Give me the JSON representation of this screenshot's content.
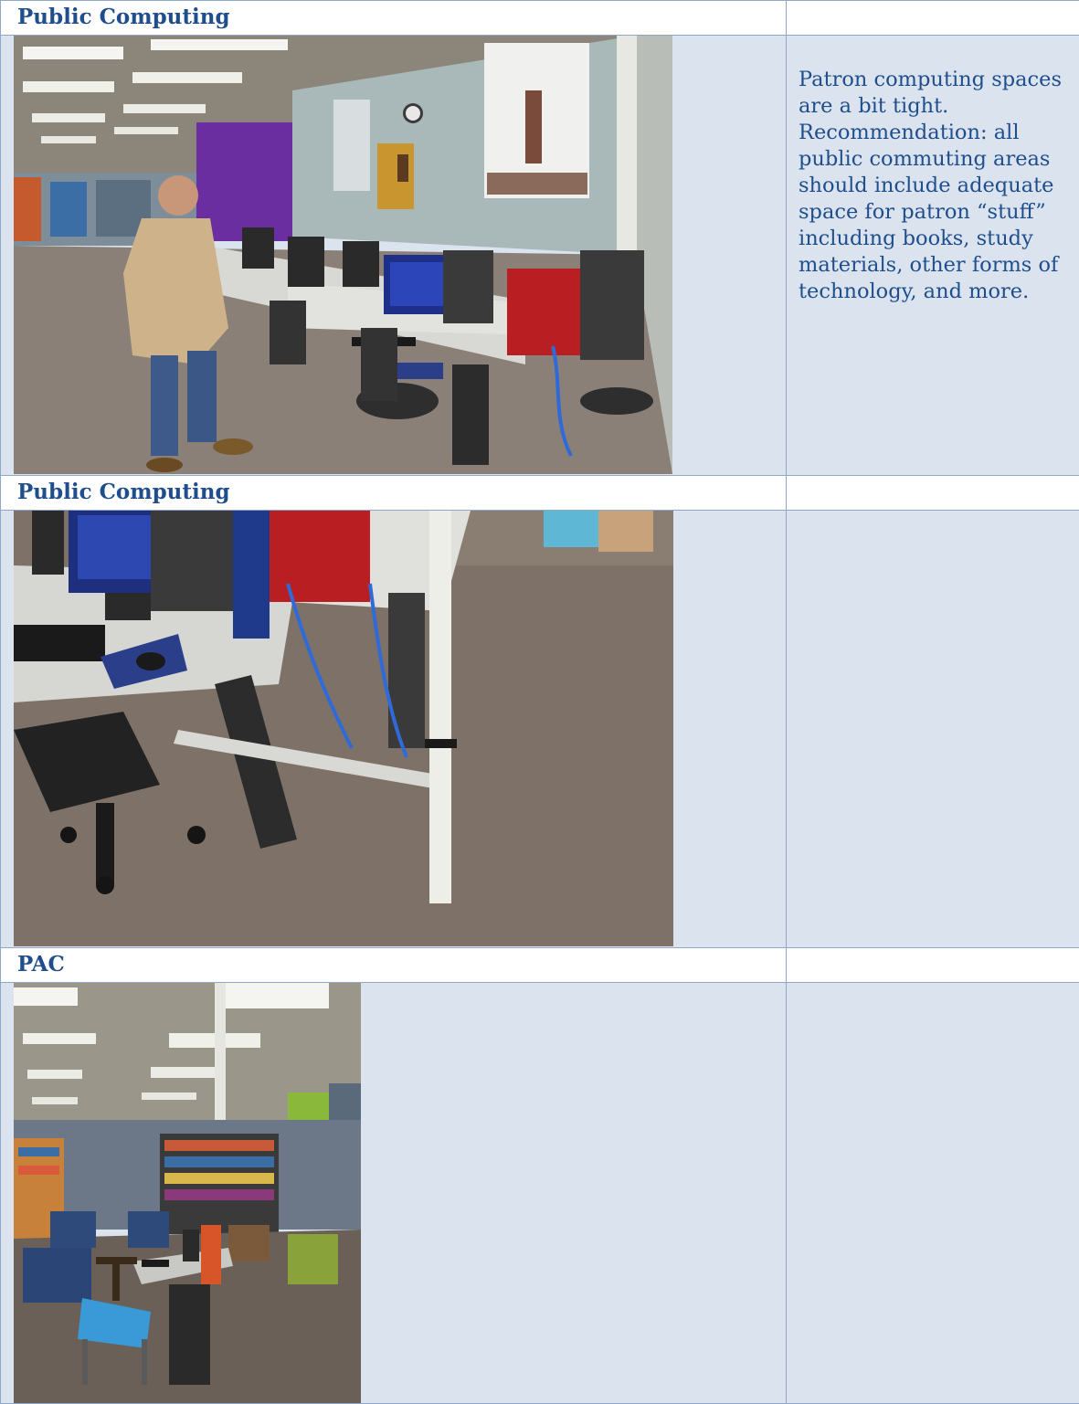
{
  "rows": [
    {
      "heading": "Public Computing",
      "note": "Patron computing spaces are a bit tight. Recommendation:  all public commuting areas should include adequate space for patron “stuff” including books, study materials, other forms of technology, and more."
    },
    {
      "heading": "Public Computing",
      "note": ""
    },
    {
      "heading": "PAC",
      "note": ""
    }
  ]
}
